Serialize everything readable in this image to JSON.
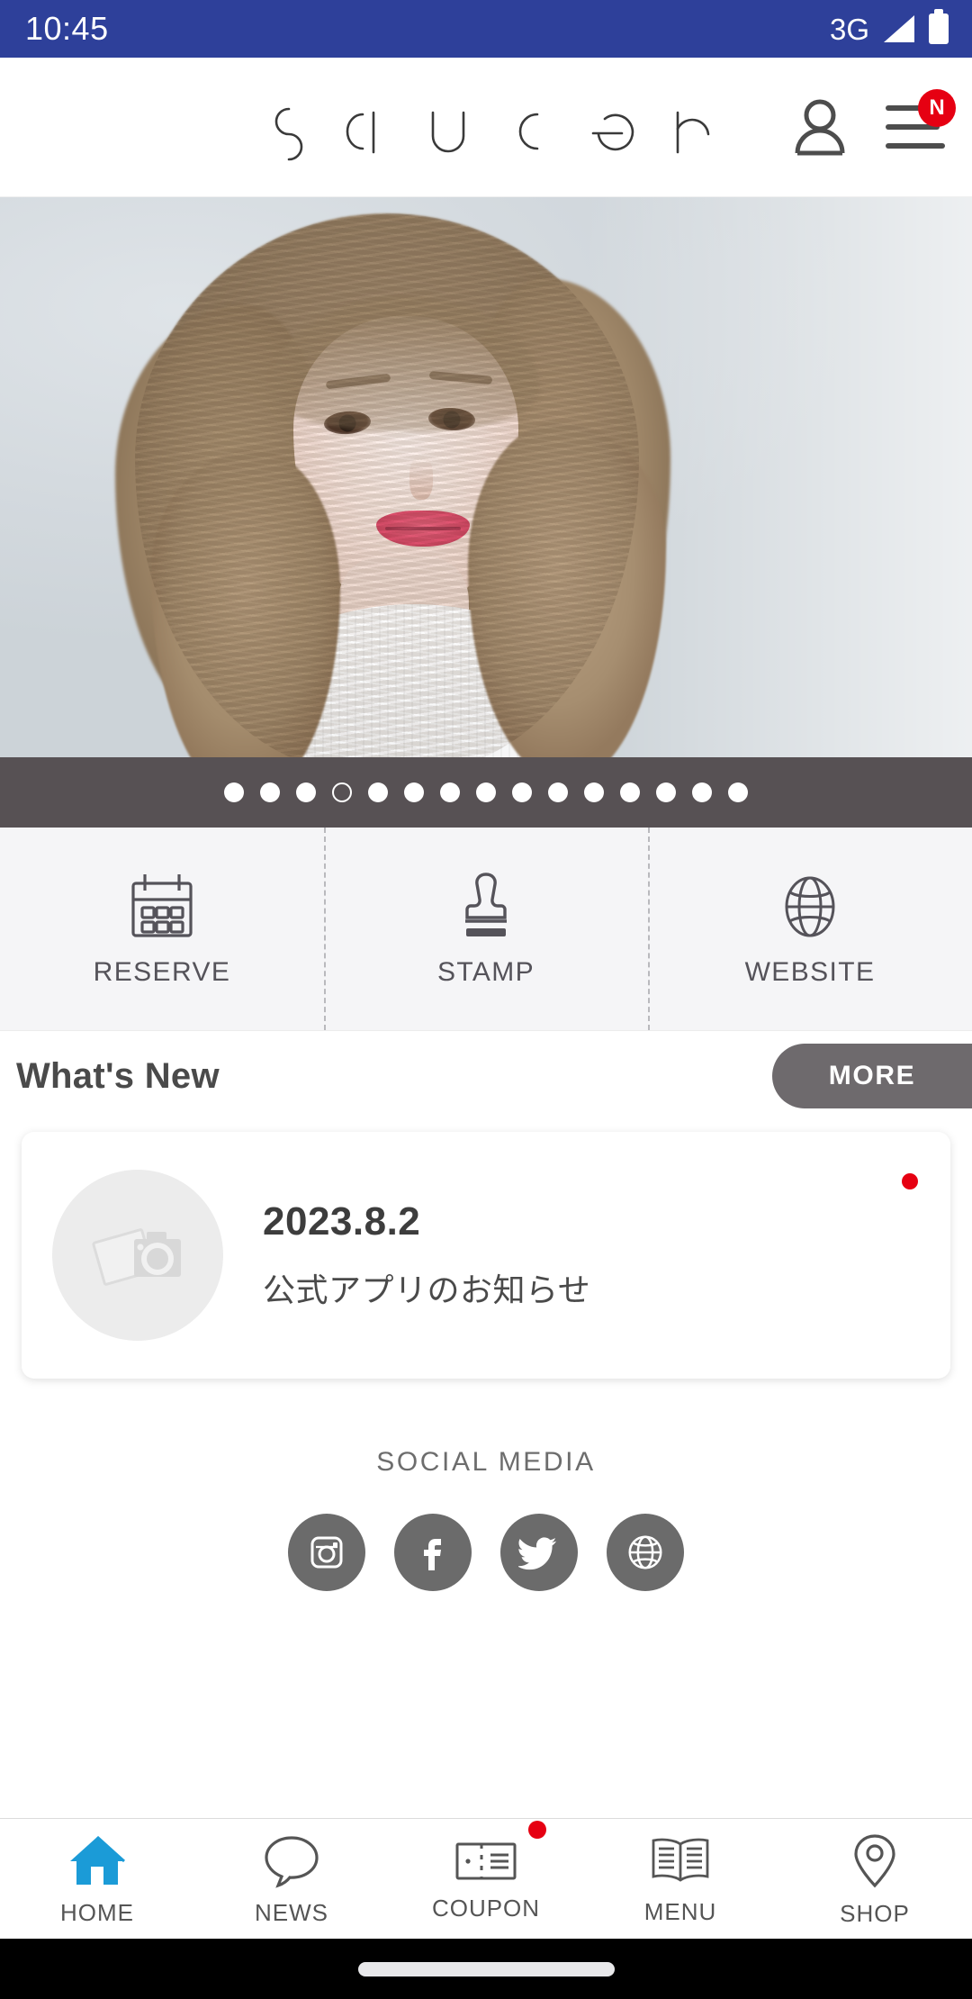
{
  "status_bar": {
    "time": "10:45",
    "network": "3G",
    "signal_icon": "signal-triangle-icon",
    "battery_icon": "battery-icon",
    "background_color": "#2e409a"
  },
  "header": {
    "brand": "saucer",
    "account_icon": "person-icon",
    "menu_icon": "hamburger-menu-icon",
    "menu_badge": "N",
    "badge_color": "#e60012"
  },
  "hero": {
    "alt": "hair-salon-model-photo",
    "carousel": {
      "total_dots": 15,
      "active_index": 3
    }
  },
  "quick_actions": [
    {
      "label": "RESERVE",
      "icon": "calendar-icon"
    },
    {
      "label": "STAMP",
      "icon": "stamp-icon"
    },
    {
      "label": "WEBSITE",
      "icon": "globe-icon"
    }
  ],
  "whats_new": {
    "title": "What's New",
    "more_label": "MORE"
  },
  "news_items": [
    {
      "date": "2023.8.2",
      "title": "公式アプリのお知らせ",
      "thumb_icon": "photo-camera-placeholder-icon",
      "unread": true
    }
  ],
  "social": {
    "title": "SOCIAL MEDIA",
    "links": [
      {
        "name": "instagram-icon"
      },
      {
        "name": "facebook-icon"
      },
      {
        "name": "twitter-icon"
      },
      {
        "name": "website-globe-icon"
      }
    ]
  },
  "bottom_nav": {
    "active_color": "#1b9bd7",
    "items": [
      {
        "label": "HOME",
        "icon": "home-icon",
        "active": true,
        "badge": false
      },
      {
        "label": "NEWS",
        "icon": "speech-bubble-icon",
        "active": false,
        "badge": false
      },
      {
        "label": "COUPON",
        "icon": "ticket-icon",
        "active": false,
        "badge": true
      },
      {
        "label": "MENU",
        "icon": "open-book-icon",
        "active": false,
        "badge": false
      },
      {
        "label": "SHOP",
        "icon": "location-pin-icon",
        "active": false,
        "badge": false
      }
    ]
  },
  "gesture_bar": {
    "handle": "home-gesture-pill"
  }
}
